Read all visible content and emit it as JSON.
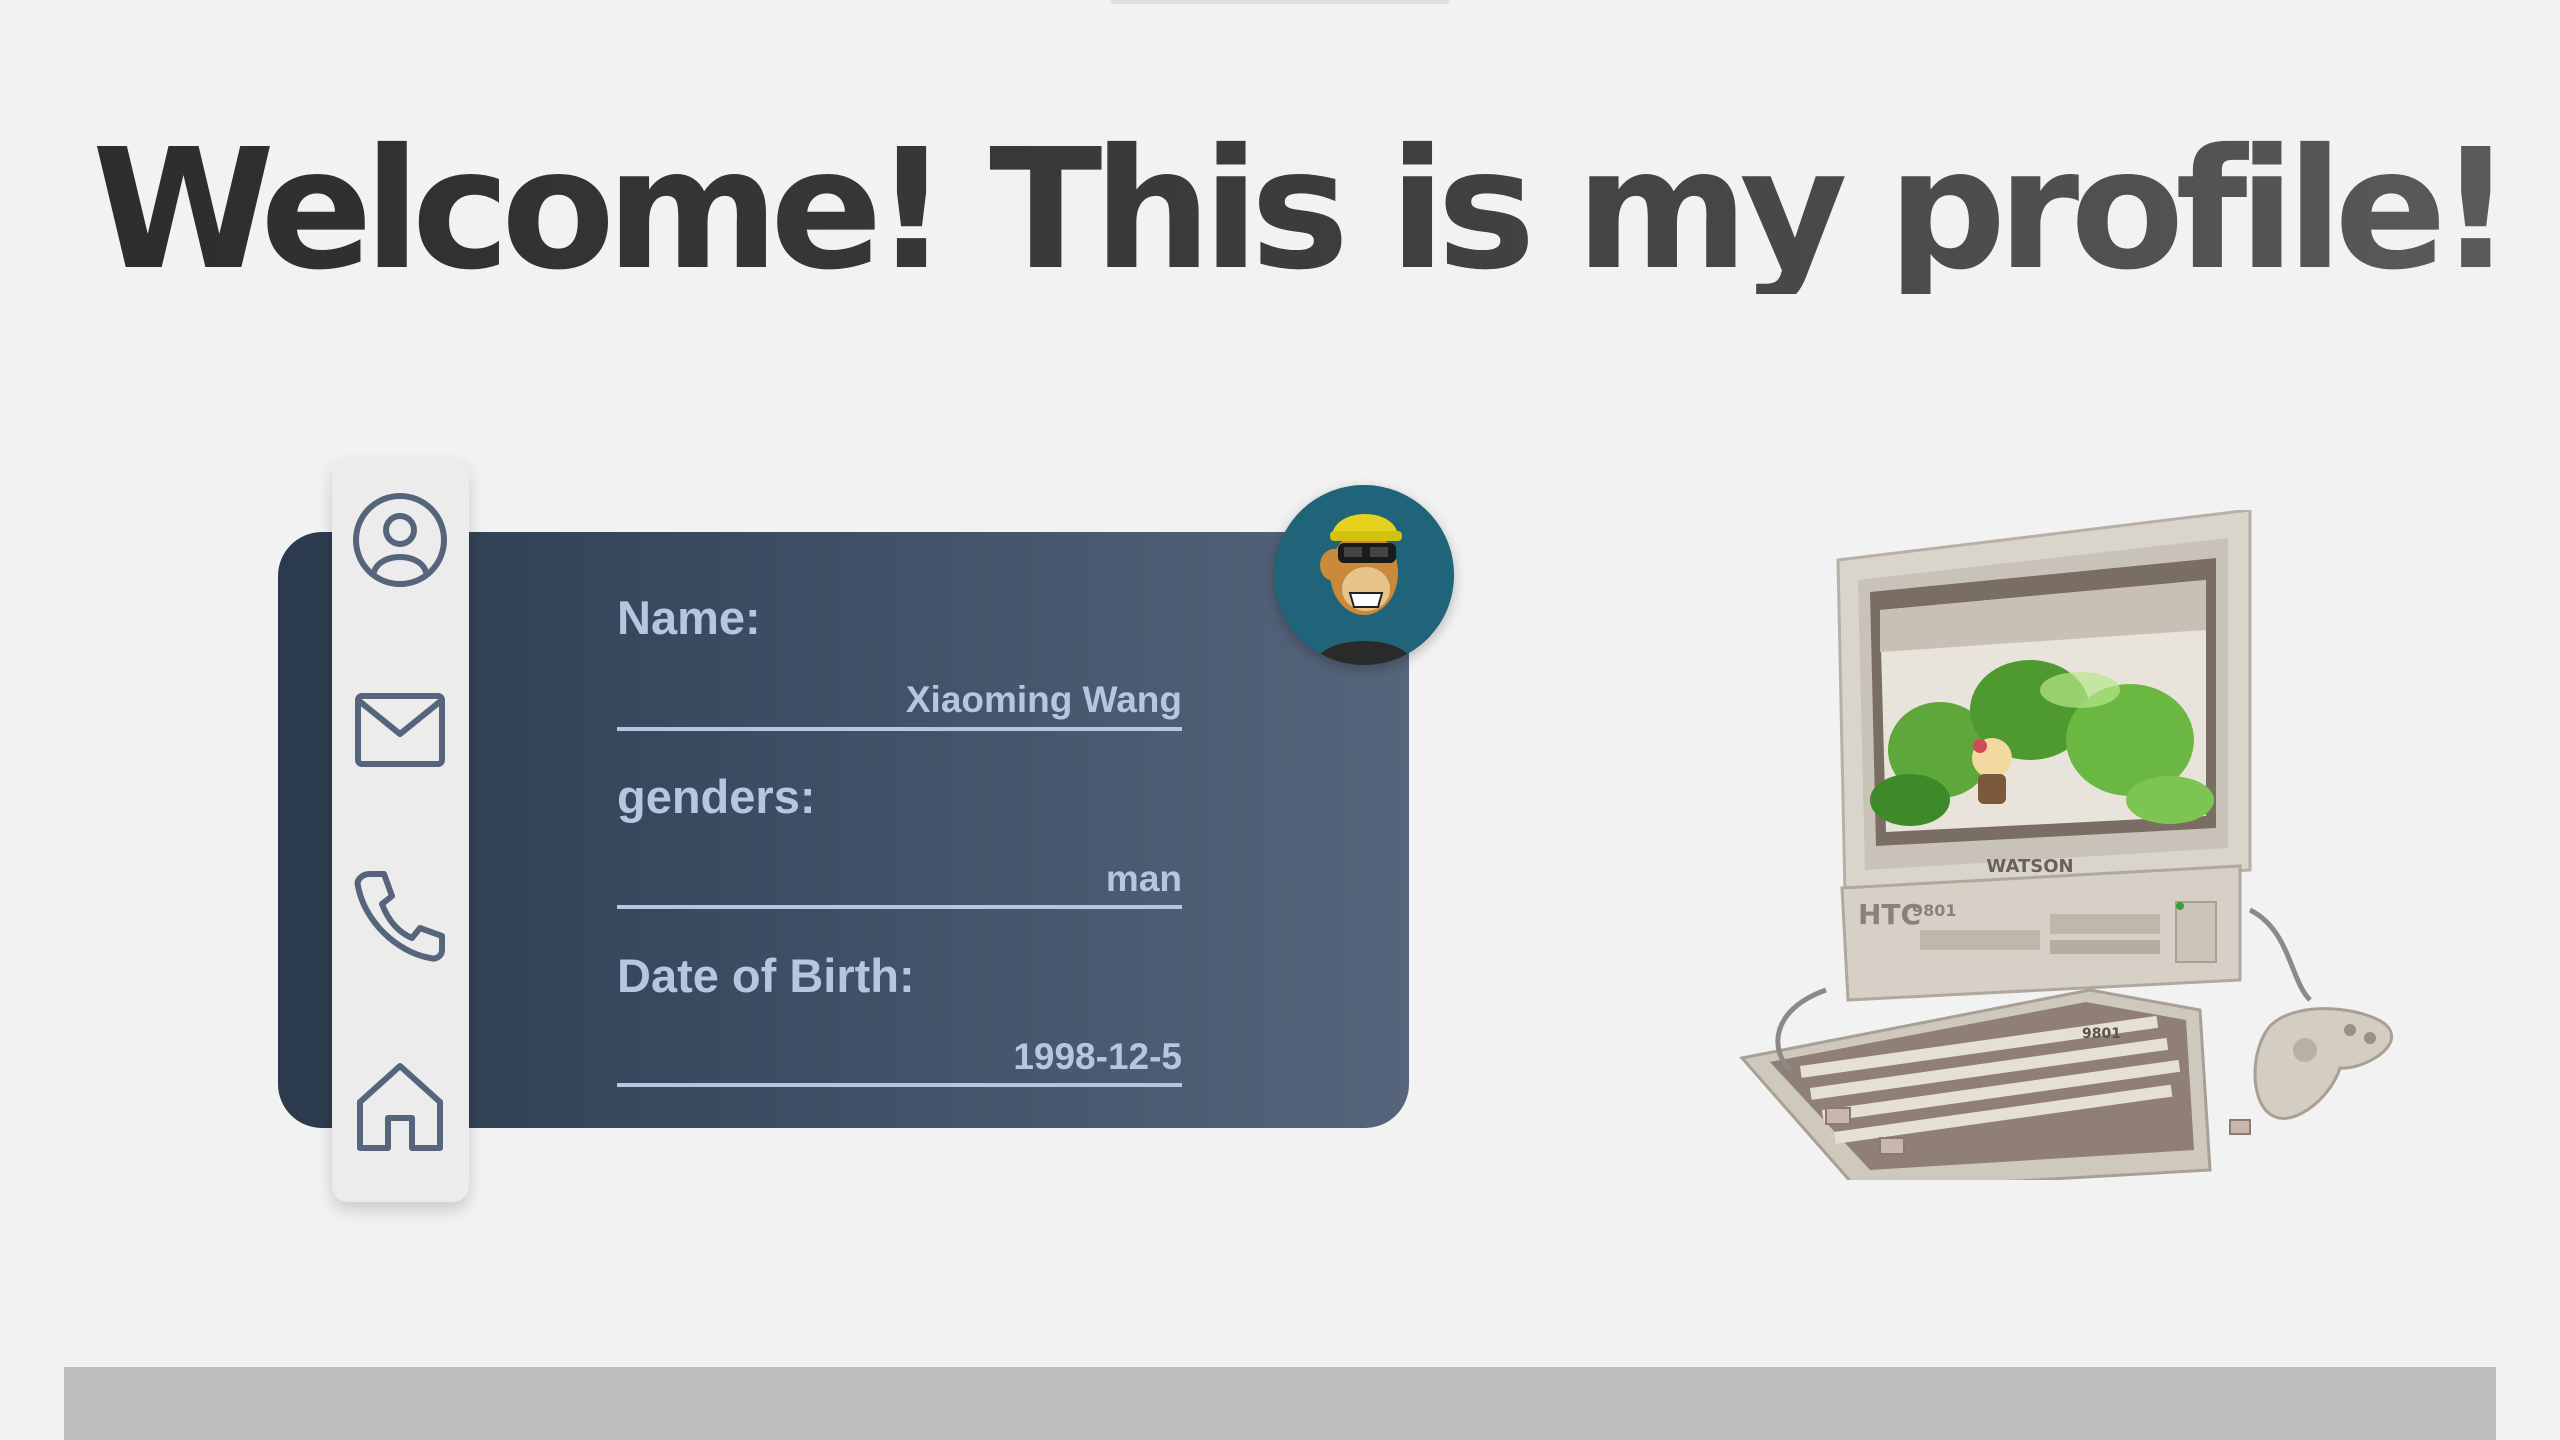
{
  "title": "Welcome! This is my profile!",
  "sidebar": {
    "items": [
      {
        "icon": "user-circle-icon"
      },
      {
        "icon": "mail-icon"
      },
      {
        "icon": "phone-icon"
      },
      {
        "icon": "home-icon"
      }
    ]
  },
  "profile": {
    "fields": [
      {
        "label": "Name:",
        "value": "Xiaoming Wang"
      },
      {
        "label": "genders:",
        "value": "man"
      },
      {
        "label": "Date of Birth:",
        "value": "1998-12-5"
      }
    ]
  },
  "computer": {
    "brand": "WATSON",
    "model": "HTC",
    "model_number": "9801",
    "keyboard_number": "9801"
  },
  "colors": {
    "background": "#f2f2f2",
    "card_start": "#2c3a4d",
    "card_end": "#56657b",
    "text_accent": "#b4c6e0",
    "icon_stroke": "#56657b",
    "avatar_bg": "#1f6479",
    "footer": "#bdbdbd"
  }
}
